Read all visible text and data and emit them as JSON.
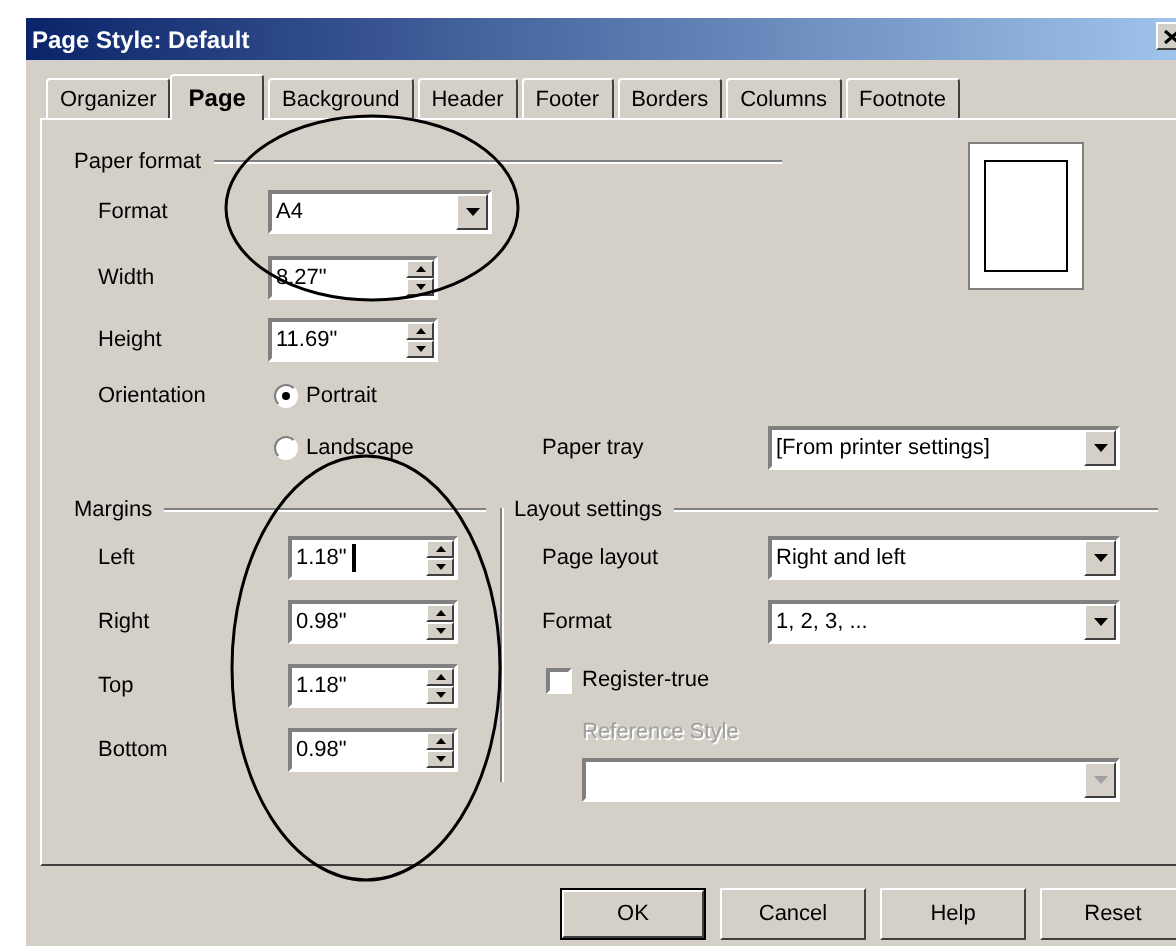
{
  "window": {
    "title": "Page Style: Default"
  },
  "tabs": [
    {
      "label": "Organizer",
      "selected": false
    },
    {
      "label": "Page",
      "selected": true
    },
    {
      "label": "Background",
      "selected": false
    },
    {
      "label": "Header",
      "selected": false
    },
    {
      "label": "Footer",
      "selected": false
    },
    {
      "label": "Borders",
      "selected": false
    },
    {
      "label": "Columns",
      "selected": false
    },
    {
      "label": "Footnote",
      "selected": false
    }
  ],
  "paper_format": {
    "heading": "Paper format",
    "format": {
      "label": "Format",
      "value": "A4"
    },
    "width": {
      "label": "Width",
      "value": "8.27\""
    },
    "height": {
      "label": "Height",
      "value": "11.69\""
    },
    "orientation": {
      "label": "Orientation",
      "options": [
        {
          "label": "Portrait",
          "selected": true
        },
        {
          "label": "Landscape",
          "selected": false
        }
      ]
    },
    "paper_tray": {
      "label": "Paper tray",
      "value": "[From printer settings]"
    }
  },
  "margins": {
    "heading": "Margins",
    "fields": [
      {
        "label": "Left",
        "value": "1.18\"",
        "focused": true
      },
      {
        "label": "Right",
        "value": "0.98\"",
        "focused": false
      },
      {
        "label": "Top",
        "value": "1.18\"",
        "focused": false
      },
      {
        "label": "Bottom",
        "value": "0.98\"",
        "focused": false
      }
    ]
  },
  "layout_settings": {
    "heading": "Layout settings",
    "page_layout": {
      "label": "Page layout",
      "value": "Right and left"
    },
    "format": {
      "label": "Format",
      "value": "1, 2, 3, ..."
    },
    "register_true": {
      "label": "Register-true",
      "checked": false
    },
    "reference_style": {
      "label": "Reference Style",
      "disabled": true
    }
  },
  "buttons": [
    {
      "label": "OK",
      "default": true
    },
    {
      "label": "Cancel",
      "default": false
    },
    {
      "label": "Help",
      "default": false
    },
    {
      "label": "Reset",
      "default": false
    }
  ]
}
